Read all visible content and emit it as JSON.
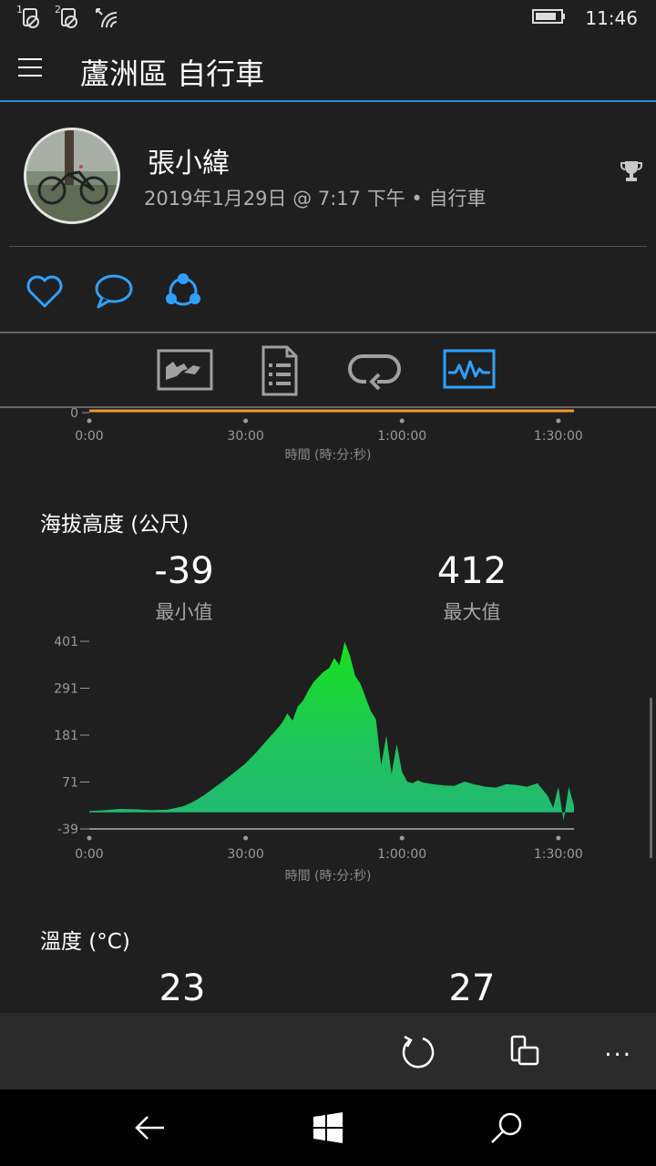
{
  "status_bar": {
    "sim1": "1",
    "sim2": "2",
    "time": "11:46"
  },
  "title_bar": {
    "title": "蘆洲區 自行車",
    "menu_icon": "hamburger-icon"
  },
  "header": {
    "user_name": "張小緯",
    "activity_meta": "2019年1月29日 @ 7:17 下午 • 自行車",
    "trophy_icon": "trophy-icon",
    "actions": [
      {
        "icon": "heart-icon"
      },
      {
        "icon": "comment-icon"
      },
      {
        "icon": "share-icon"
      }
    ]
  },
  "tabs": [
    {
      "icon": "map-tab-icon",
      "active": false
    },
    {
      "icon": "details-tab-icon",
      "active": false
    },
    {
      "icon": "laps-tab-icon",
      "active": false
    },
    {
      "icon": "charts-tab-icon",
      "active": true
    }
  ],
  "colors": {
    "accent": "#2ea1ff",
    "elevation_fill": "#1fb86a",
    "elevation_peak": "#17e31b",
    "top_line": "#f09a2a",
    "background": "#1f1f1f"
  },
  "top_chart": {
    "y_tick": "0",
    "x_ticks": [
      "0:00",
      "30:00",
      "1:00:00",
      "1:30:00"
    ],
    "x_title": "時間 (時:分:秒)"
  },
  "elevation": {
    "section_title": "海拔高度 (公尺)",
    "min_value": "-39",
    "min_label": "最小值",
    "max_value": "412",
    "max_label": "最大值"
  },
  "temperature": {
    "section_title": "溫度 (°C)",
    "min_value": "23",
    "max_value": "27"
  },
  "chart_data": {
    "type": "area",
    "title": "海拔高度 (公尺)",
    "xlabel": "時間 (時:分:秒)",
    "ylabel": "",
    "x_tick_labels": [
      "0:00",
      "30:00",
      "1:00:00",
      "1:30:00"
    ],
    "y_tick_labels": [
      "401",
      "291",
      "181",
      "71",
      "-39"
    ],
    "ylim": [
      -39,
      401
    ],
    "xlim_minutes": [
      0,
      93
    ],
    "series": [
      {
        "x_minutes": [
          0,
          3,
          6,
          9,
          12,
          15,
          18,
          20,
          22,
          24,
          26,
          28,
          30,
          32,
          34,
          36,
          37,
          38,
          39,
          40,
          41,
          42,
          43,
          44,
          45,
          46,
          47,
          48,
          49,
          50,
          51,
          52,
          53,
          54,
          55,
          56,
          57,
          58,
          59,
          60,
          61,
          62,
          63,
          64,
          66,
          68,
          70,
          72,
          74,
          76,
          78,
          80,
          82,
          84,
          86,
          88,
          89,
          90,
          91,
          92,
          93
        ],
        "values": [
          3,
          5,
          8,
          7,
          5,
          6,
          14,
          25,
          40,
          58,
          76,
          95,
          115,
          140,
          168,
          195,
          210,
          232,
          215,
          248,
          262,
          285,
          305,
          318,
          330,
          338,
          362,
          345,
          400,
          368,
          320,
          302,
          270,
          238,
          218,
          110,
          180,
          90,
          160,
          95,
          72,
          68,
          75,
          70,
          66,
          63,
          62,
          72,
          65,
          60,
          58,
          66,
          64,
          60,
          68,
          38,
          10,
          60,
          -20,
          60,
          15
        ]
      }
    ]
  },
  "app_bar": {
    "refresh_icon": "refresh-icon",
    "device_icon": "send-to-device-icon",
    "more": "..."
  },
  "nav_bar": {
    "back_icon": "back-arrow-icon",
    "home_icon": "windows-logo-icon",
    "search_icon": "search-icon"
  }
}
